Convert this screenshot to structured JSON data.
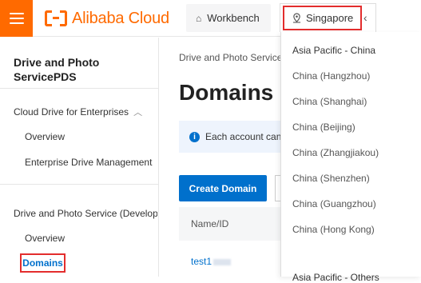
{
  "topbar": {
    "brand": "Alibaba Cloud",
    "workbench_label": "Workbench",
    "region_label": "Singapore",
    "colors": {
      "accent": "#ff6a00",
      "highlight": "#e32d2d",
      "link": "#0070cc"
    },
    "icons": [
      "menu-icon",
      "home-icon",
      "location-pin-icon",
      "chevron-left-icon"
    ]
  },
  "sidebar": {
    "product_title": "Drive and Photo ServicePDS",
    "group1": {
      "label": "Cloud Drive for Enterprises",
      "items": [
        "Overview",
        "Enterprise Drive Management"
      ]
    },
    "group2": {
      "label": "Drive and Photo Service (Developer)",
      "items": [
        "Overview",
        "Domains"
      ]
    },
    "active_item": "Domains"
  },
  "main": {
    "breadcrumb": "Drive and Photo Service",
    "title": "Domains",
    "notice": "Each account can",
    "create_button": "Create Domain",
    "table": {
      "columns": [
        "Name/ID"
      ],
      "rows": [
        {
          "name": "test1"
        }
      ]
    }
  },
  "region_dropdown": {
    "header": "Asia Pacific - China",
    "options": [
      "China (Hangzhou)",
      "China (Shanghai)",
      "China (Beijing)",
      "China (Zhangjiakou)",
      "China (Shenzhen)",
      "China (Guangzhou)",
      "China (Hong Kong)"
    ],
    "next_header": "Asia Pacific - Others"
  }
}
